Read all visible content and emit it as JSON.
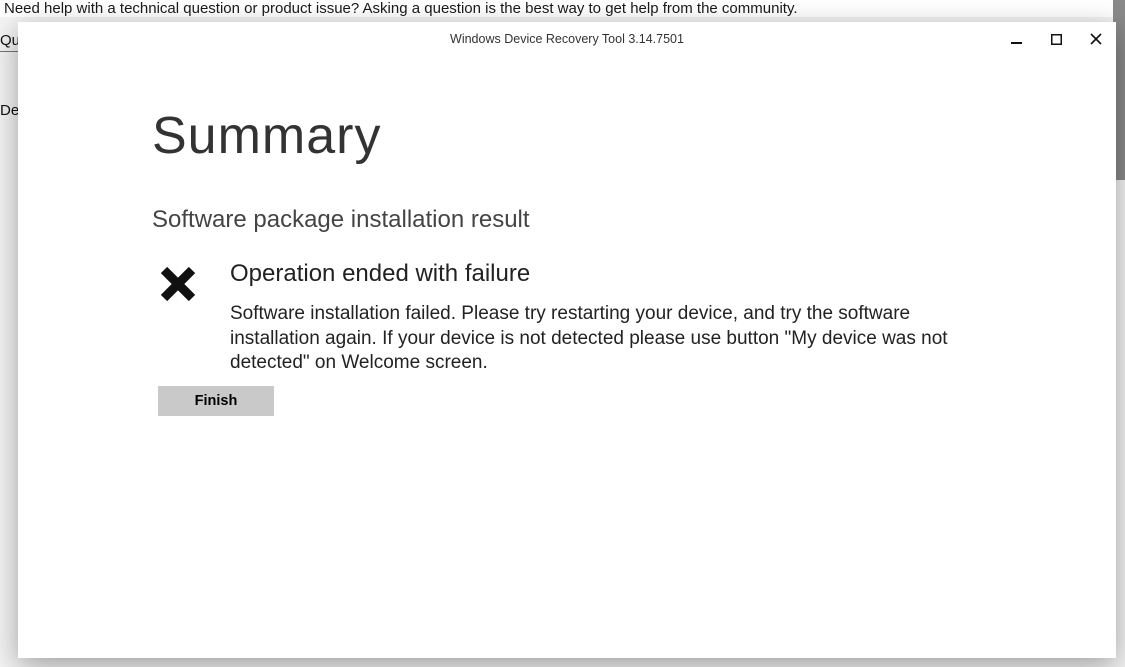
{
  "background": {
    "help_text": "Need help with a technical question or product issue? Asking a question is the best way to get help from the community.",
    "side_labels": [
      "Qu",
      "De"
    ]
  },
  "window": {
    "title": "Windows Device Recovery Tool 3.14.7501"
  },
  "content": {
    "page_title": "Summary",
    "section_heading": "Software package installation result",
    "result_title": "Operation ended with failure",
    "result_description": "Software installation failed. Please try restarting your device, and try the software installation again. If your device is not detected please use button \"My device was not detected\" on Welcome screen.",
    "finish_label": "Finish"
  }
}
